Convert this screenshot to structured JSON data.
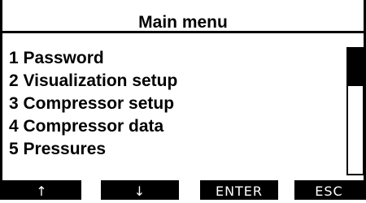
{
  "header": {
    "title": "Main menu"
  },
  "menu": {
    "items": [
      {
        "label": "1 Password"
      },
      {
        "label": "2 Visualization setup"
      },
      {
        "label": "3 Compressor setup"
      },
      {
        "label": "4 Compressor data"
      },
      {
        "label": "5 Pressures"
      }
    ]
  },
  "scrollbar": {
    "visible_fraction": 0.3
  },
  "softkeys": {
    "up_label": "↑",
    "down_label": "↓",
    "enter_label": "ENTER",
    "esc_label": "ESC"
  },
  "colors": {
    "background": "#ffffff",
    "foreground": "#000000"
  }
}
